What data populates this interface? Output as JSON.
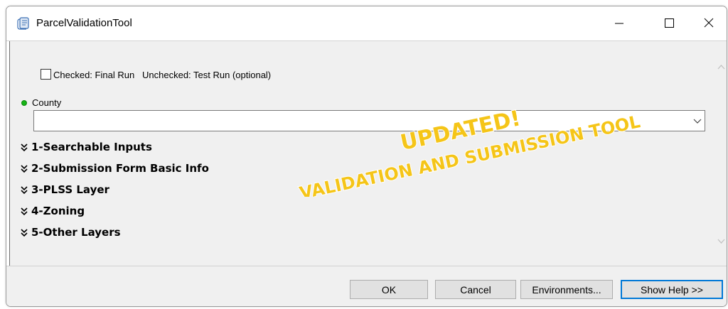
{
  "window": {
    "title": "ParcelValidationTool",
    "icon": "script-scroll-icon",
    "controls": [
      "minimize-icon",
      "maximize-icon",
      "close-icon"
    ]
  },
  "options": {
    "final_run_label": "Checked: Final Run   Unchecked: Test Run (optional)",
    "final_run_checked": false
  },
  "county": {
    "label": "County",
    "value": "",
    "required_indicator_color": "#16b416"
  },
  "sections": [
    {
      "label": "1-Searchable Inputs"
    },
    {
      "label": "2-Submission Form Basic Info"
    },
    {
      "label": "3-PLSS Layer"
    },
    {
      "label": "4-Zoning"
    },
    {
      "label": "5-Other Layers"
    }
  ],
  "overlay": {
    "line1": "UPDATED!",
    "line2": "VALIDATION AND SUBMISSION TOOL",
    "color": "#f5c518"
  },
  "buttons": {
    "ok": "OK",
    "cancel": "Cancel",
    "environments": "Environments...",
    "show_help": "Show Help >>"
  }
}
